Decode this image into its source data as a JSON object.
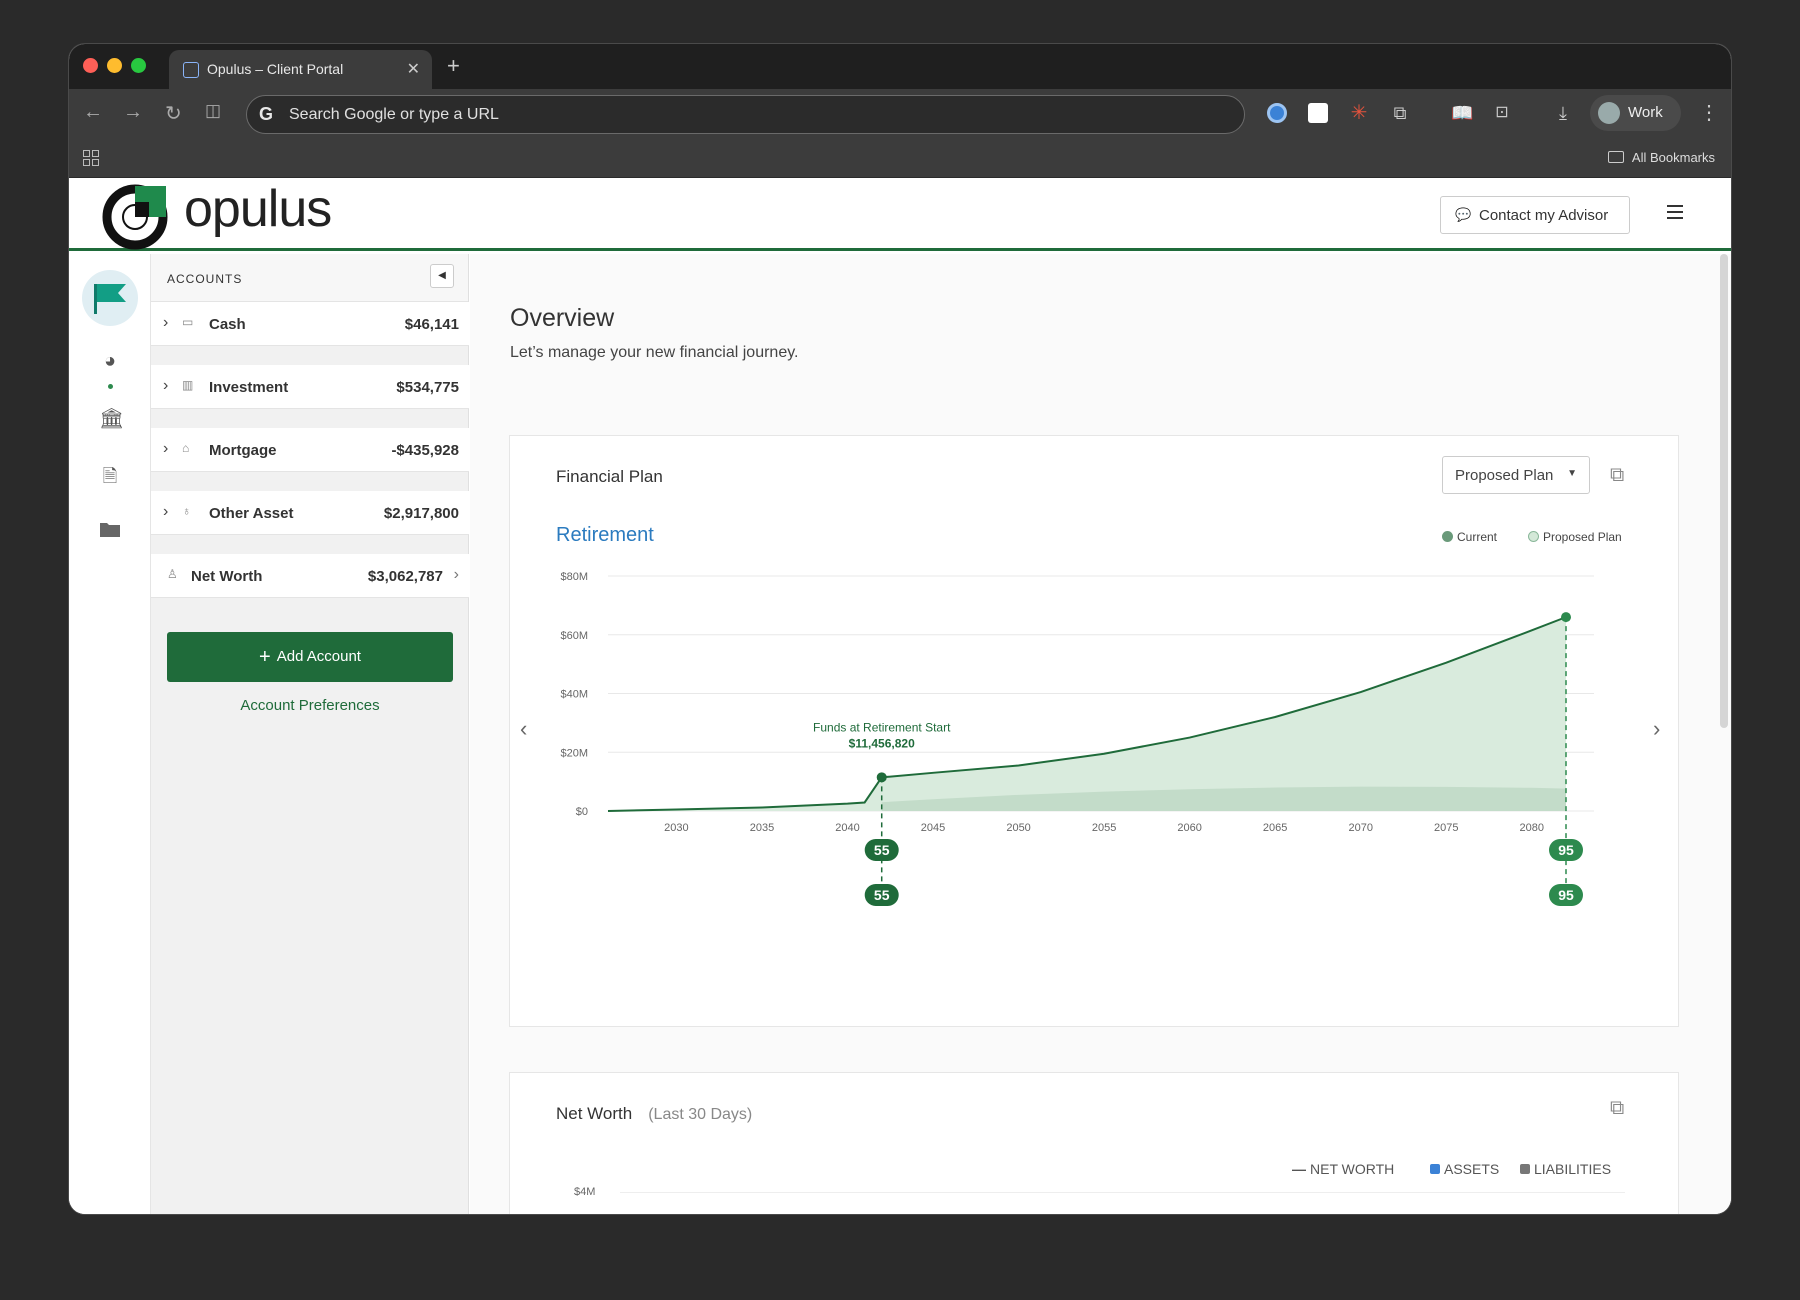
{
  "browser": {
    "tab_title": "Opulus – Client Portal",
    "omnibox_placeholder": "Search Google or type a URL",
    "profile_label": "Work",
    "bookmarks_label": "All Bookmarks"
  },
  "header": {
    "logo_text": "opulus",
    "contact_label": "Contact my Advisor"
  },
  "sidebar": {
    "heading": "ACCOUNTS",
    "accounts": [
      {
        "name": "Cash",
        "value": "$46,141",
        "icon": "cash-icon"
      },
      {
        "name": "Investment",
        "value": "$534,775",
        "icon": "chart-icon"
      },
      {
        "name": "Mortgage",
        "value": "-$435,928",
        "icon": "house-icon"
      },
      {
        "name": "Other Asset",
        "value": "$2,917,800",
        "icon": "piggy-bank-icon"
      }
    ],
    "net_worth": {
      "name": "Net Worth",
      "value": "$3,062,787"
    },
    "add_account_label": "Add Account",
    "preferences_label": "Account Preferences"
  },
  "overview": {
    "title": "Overview",
    "subtitle": "Let’s manage your new financial journey."
  },
  "financial_plan": {
    "title": "Financial Plan",
    "plan_select": "Proposed Plan",
    "section": "Retirement",
    "legend_current": "Current",
    "legend_proposed": "Proposed Plan",
    "annotation_title": "Funds at Retirement Start",
    "annotation_value": "$11,456,820",
    "marker_start": "55",
    "marker_end": "95",
    "colors": {
      "line": "#1f6b3a",
      "current_fill": "#c3dcc9",
      "proposed_fill": "#d9ebdd",
      "marker": "#1f6b3a",
      "end_marker": "#2d8a4e"
    }
  },
  "net_worth_card": {
    "title": "Net Worth",
    "period": "(Last 30 Days)",
    "legend": [
      "NET WORTH",
      "ASSETS",
      "LIABILITIES"
    ],
    "y_top_label": "$4M",
    "colors": {
      "assets": "#3b82d6",
      "liabilities": "#777777"
    }
  },
  "chart_data": {
    "type": "area",
    "title": "Retirement",
    "xlabel": "",
    "ylabel": "",
    "x_ticks": [
      "2030",
      "2035",
      "2040",
      "2045",
      "2050",
      "2055",
      "2060",
      "2065",
      "2070",
      "2075",
      "2080"
    ],
    "y_ticks": [
      "$0",
      "$20M",
      "$40M",
      "$60M",
      "$80M"
    ],
    "ylim": [
      0,
      80000000
    ],
    "xlim": [
      2026,
      2082
    ],
    "series": [
      {
        "name": "Proposed Plan",
        "x": [
          2026,
          2030,
          2035,
          2040,
          2041,
          2042,
          2045,
          2050,
          2055,
          2060,
          2065,
          2070,
          2075,
          2080,
          2082
        ],
        "values": [
          0,
          500000,
          1200000,
          2500000,
          2900000,
          11456820,
          13000000,
          15500000,
          19500000,
          25000000,
          32000000,
          40500000,
          50500000,
          61500000,
          66000000
        ]
      },
      {
        "name": "Current",
        "x": [
          2042,
          2045,
          2050,
          2055,
          2060,
          2065,
          2070,
          2075,
          2080,
          2082
        ],
        "values": [
          3000000,
          4000000,
          5500000,
          6600000,
          7400000,
          8000000,
          8300000,
          8200000,
          7900000,
          7600000
        ]
      }
    ],
    "annotation": {
      "x": 2042,
      "y": 11456820,
      "text": "Funds at Retirement Start",
      "value": "$11,456,820"
    },
    "legend": "top-right",
    "grid": true
  }
}
